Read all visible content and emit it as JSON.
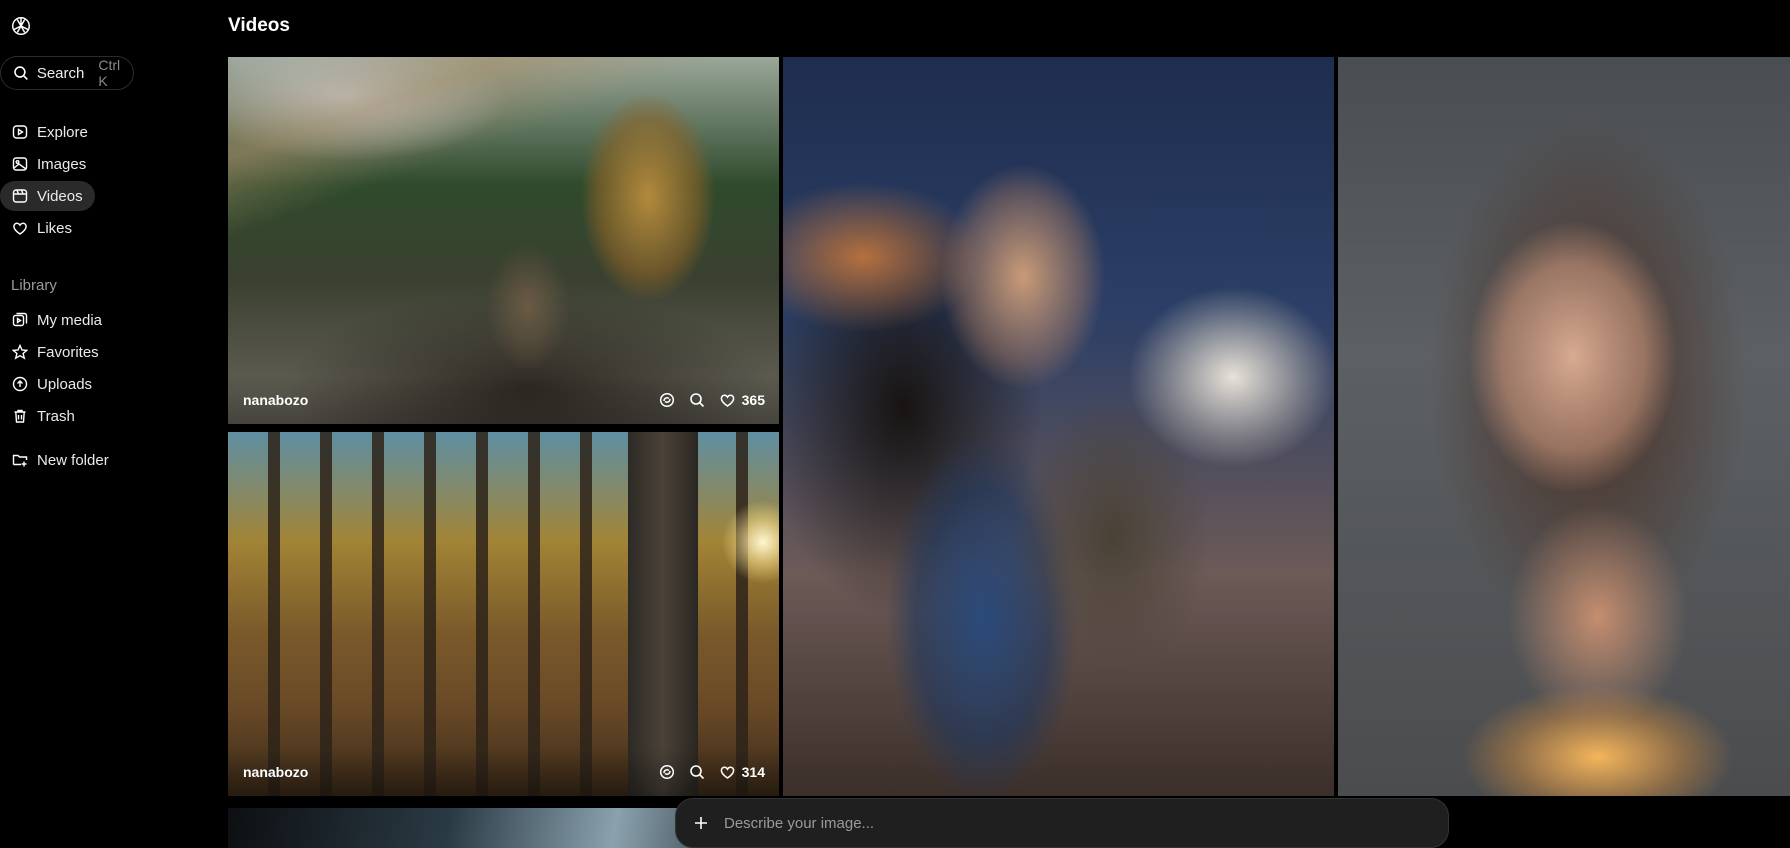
{
  "sidebar": {
    "search": {
      "label": "Search",
      "shortcut": "Ctrl K"
    },
    "nav": [
      {
        "label": "Explore",
        "icon": "explore-icon"
      },
      {
        "label": "Images",
        "icon": "images-icon"
      },
      {
        "label": "Videos",
        "icon": "videos-icon",
        "active": true
      },
      {
        "label": "Likes",
        "icon": "heart-icon"
      }
    ],
    "library_heading": "Library",
    "library": [
      {
        "label": "My media",
        "icon": "my-media-icon"
      },
      {
        "label": "Favorites",
        "icon": "star-icon"
      },
      {
        "label": "Uploads",
        "icon": "upload-icon"
      },
      {
        "label": "Trash",
        "icon": "trash-icon"
      }
    ],
    "new_folder": "New folder"
  },
  "main": {
    "title": "Videos",
    "tiles": [
      {
        "author": "nanabozo",
        "likes": "365"
      },
      {
        "author": "nanabozo",
        "likes": "314"
      }
    ]
  },
  "prompt": {
    "placeholder": "Describe your image..."
  },
  "colors": {
    "background": "#000000",
    "active_nav": "#2a2a2a",
    "prompt_bg": "#1f1f1f"
  }
}
